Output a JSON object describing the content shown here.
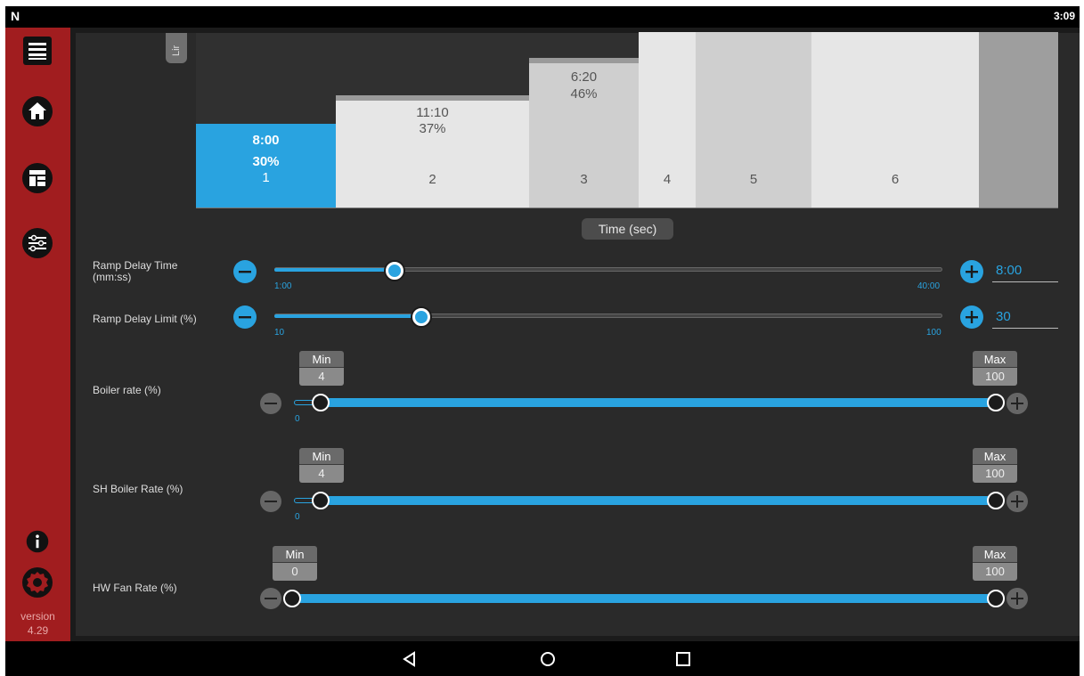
{
  "status_bar": {
    "logo": "N",
    "time": "3:09"
  },
  "sidebar": {
    "items": [
      {
        "name": "menu-icon"
      },
      {
        "name": "home-icon"
      },
      {
        "name": "dashboard-icon"
      },
      {
        "name": "sliders-icon"
      },
      {
        "name": "info-icon"
      },
      {
        "name": "settings-gear-icon"
      }
    ],
    "version_label": "version",
    "version_number": "4.29"
  },
  "chart_data": {
    "type": "bar",
    "categories": [
      "1",
      "2",
      "3",
      "4",
      "5",
      "6"
    ],
    "series": [
      {
        "times": [
          "8:00",
          "11:10",
          "6:20",
          "",
          "",
          ""
        ],
        "percents": [
          "30%",
          "37%",
          "46%",
          "",
          "",
          ""
        ]
      }
    ],
    "side_tab": "Lir",
    "xlabel": "Time (sec)",
    "colors": {
      "active": "#29a3e0",
      "bar_light": "#e6e6e6",
      "bar_mid": "#cfcfcf",
      "bar_dark": "#9e9e9e"
    }
  },
  "controls": {
    "ramp_delay_time": {
      "label_line1": "Ramp Delay Time",
      "label_line2": "(mm:ss)",
      "min_tick": "1:00",
      "max_tick": "40:00",
      "value": "8:00",
      "level": 0.18
    },
    "ramp_delay_limit": {
      "label": "Ramp Delay Limit (%)",
      "min_tick": "10",
      "max_tick": "100",
      "value": "30",
      "level": 0.22
    },
    "boiler_rate": {
      "label": "Boiler rate (%)",
      "min_title": "Min",
      "min_value": "4",
      "max_title": "Max",
      "max_value": "100",
      "zero_tick": "0"
    },
    "sh_boiler_rate": {
      "label": "SH Boiler Rate (%)",
      "min_title": "Min",
      "min_value": "4",
      "max_title": "Max",
      "max_value": "100",
      "zero_tick": "0"
    },
    "hw_fan_rate": {
      "label": "HW Fan Rate (%)",
      "min_title": "Min",
      "min_value": "0",
      "max_title": "Max",
      "max_value": "100"
    }
  },
  "nav_bar": {
    "back": "back-icon",
    "home": "home-circle-icon",
    "recents": "recents-icon"
  }
}
